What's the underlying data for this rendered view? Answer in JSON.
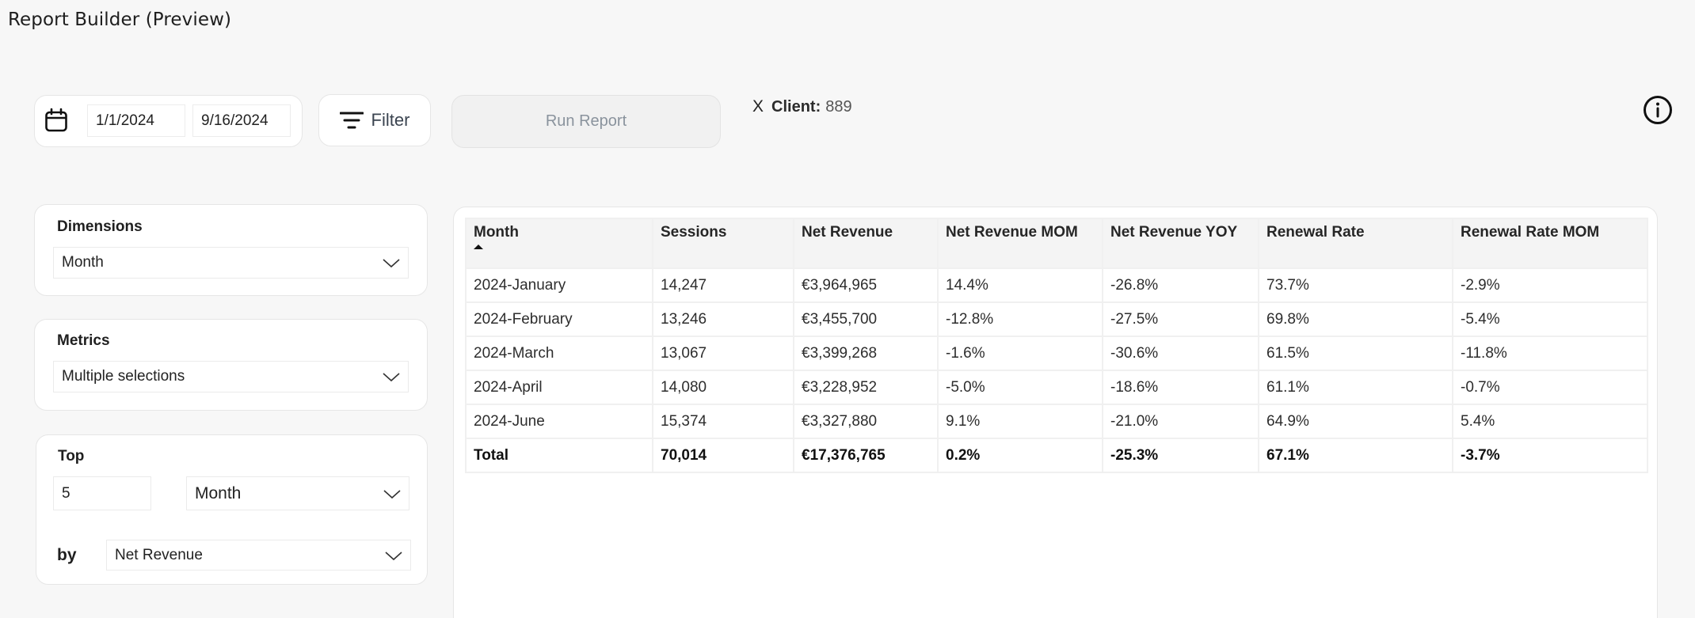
{
  "app": {
    "title": "Report Builder (Preview)"
  },
  "toolbar": {
    "date_from": "1/1/2024",
    "date_to": "9/16/2024",
    "filter_label": "Filter",
    "run_report_label": "Run Report",
    "client_filter": {
      "remove_label": "X",
      "label": "Client:",
      "value": "889"
    }
  },
  "sidebar": {
    "dimensions": {
      "label": "Dimensions",
      "selected": "Month"
    },
    "metrics": {
      "label": "Metrics",
      "selected": "Multiple selections"
    },
    "top": {
      "label": "Top",
      "count": "5",
      "dimension": "Month",
      "by_label": "by",
      "by_metric": "Net Revenue"
    }
  },
  "colors": {
    "positive": "#17806d",
    "negative": "#c8223f",
    "background": "#f7f7f7"
  },
  "table": {
    "sort": {
      "column": "Month",
      "direction": "ascending"
    },
    "columns": [
      "Month",
      "Sessions",
      "Net Revenue",
      "Net Revenue MOM",
      "Net Revenue YOY",
      "Renewal Rate",
      "Renewal Rate MOM"
    ],
    "rows": [
      [
        "2024-January",
        "14,247",
        "€3,964,965",
        "14.4%",
        "-26.8%",
        "73.7%",
        "-2.9%"
      ],
      [
        "2024-February",
        "13,246",
        "€3,455,700",
        "-12.8%",
        "-27.5%",
        "69.8%",
        "-5.4%"
      ],
      [
        "2024-March",
        "13,067",
        "€3,399,268",
        "-1.6%",
        "-30.6%",
        "61.5%",
        "-11.8%"
      ],
      [
        "2024-April",
        "14,080",
        "€3,228,952",
        "-5.0%",
        "-18.6%",
        "61.1%",
        "-0.7%"
      ],
      [
        "2024-June",
        "15,374",
        "€3,327,880",
        "9.1%",
        "-21.0%",
        "64.9%",
        "5.4%"
      ]
    ],
    "total": [
      "Total",
      "70,014",
      "€17,376,765",
      "0.2%",
      "-25.3%",
      "67.1%",
      "-3.7%"
    ],
    "signed_columns": [
      3,
      4,
      6
    ]
  }
}
